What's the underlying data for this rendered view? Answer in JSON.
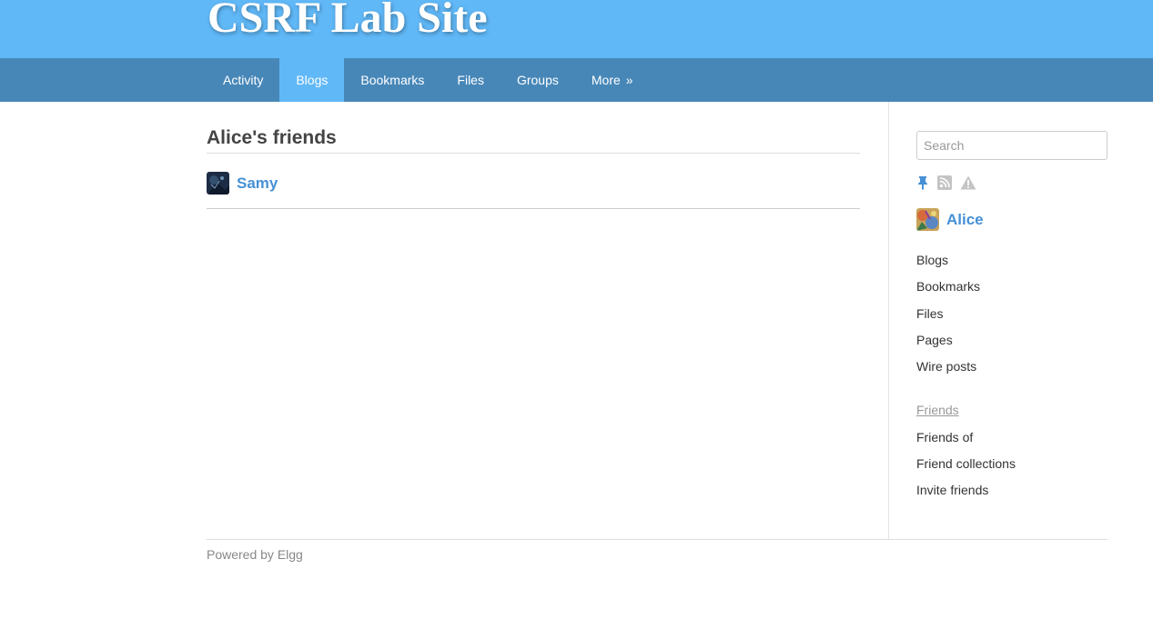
{
  "site": {
    "title": "CSRF Lab Site"
  },
  "nav": {
    "items": [
      {
        "label": "Activity"
      },
      {
        "label": "Blogs"
      },
      {
        "label": "Bookmarks"
      },
      {
        "label": "Files"
      },
      {
        "label": "Groups"
      },
      {
        "label": "More",
        "arrow": "»"
      }
    ],
    "active": "Blogs"
  },
  "main": {
    "title": "Alice's friends",
    "friends": [
      {
        "name": "Samy"
      }
    ]
  },
  "sidebar": {
    "search": {
      "placeholder": "Search"
    },
    "icons": [
      "pin-icon",
      "rss-icon",
      "report-warning-icon"
    ],
    "owner": {
      "name": "Alice"
    },
    "menu": [
      "Blogs",
      "Bookmarks",
      "Files",
      "Pages",
      "Wire posts"
    ],
    "friends_menu": [
      "Friends",
      "Friends of",
      "Friend collections",
      "Invite friends"
    ],
    "friends_menu_selected": "Friends"
  },
  "footer": {
    "text": "Powered by Elgg"
  },
  "colors": {
    "header": "#60b8f7",
    "navbar": "#4787b8",
    "link": "#4690d6"
  }
}
